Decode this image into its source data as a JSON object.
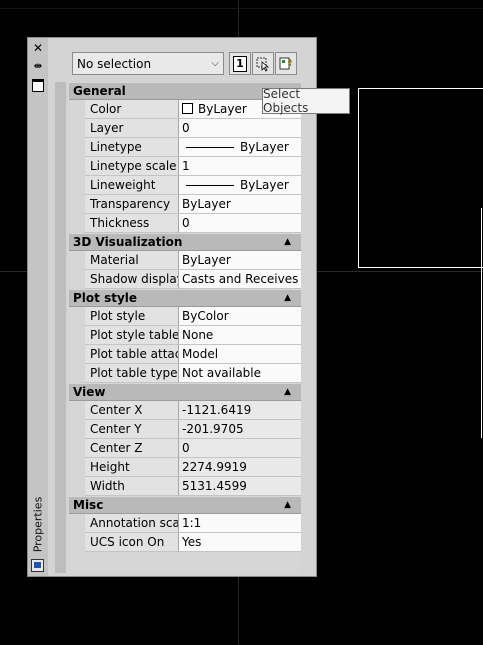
{
  "palette": {
    "title": "Properties",
    "selection": "No selection",
    "toggle_pickadd_label": "1",
    "tooltip": "Select Objects"
  },
  "categories": [
    {
      "name": "General",
      "props": [
        {
          "name": "Color",
          "value": "ByLayer",
          "swatch": true
        },
        {
          "name": "Layer",
          "value": "0"
        },
        {
          "name": "Linetype",
          "value": "ByLayer",
          "line": true
        },
        {
          "name": "Linetype scale",
          "value": "1"
        },
        {
          "name": "Lineweight",
          "value": "ByLayer",
          "line": true
        },
        {
          "name": "Transparency",
          "value": "ByLayer"
        },
        {
          "name": "Thickness",
          "value": "0"
        }
      ]
    },
    {
      "name": "3D Visualization",
      "props": [
        {
          "name": "Material",
          "value": "ByLayer"
        },
        {
          "name": "Shadow display",
          "value": "Casts and Receives ..."
        }
      ]
    },
    {
      "name": "Plot style",
      "props": [
        {
          "name": "Plot style",
          "value": "ByColor"
        },
        {
          "name": "Plot style table",
          "value": "None"
        },
        {
          "name": "Plot table attac...",
          "value": "Model"
        },
        {
          "name": "Plot table type",
          "value": "Not available"
        }
      ]
    },
    {
      "name": "View",
      "props": [
        {
          "name": "Center X",
          "value": "-1121.6419",
          "readonly": true
        },
        {
          "name": "Center Y",
          "value": "-201.9705",
          "readonly": true
        },
        {
          "name": "Center Z",
          "value": "0",
          "readonly": true
        },
        {
          "name": "Height",
          "value": "2274.9919",
          "readonly": true
        },
        {
          "name": "Width",
          "value": "5131.4599",
          "readonly": true
        }
      ]
    },
    {
      "name": "Misc",
      "props": [
        {
          "name": "Annotation scale",
          "value": "1:1"
        },
        {
          "name": "UCS icon On",
          "value": "Yes"
        }
      ]
    }
  ]
}
